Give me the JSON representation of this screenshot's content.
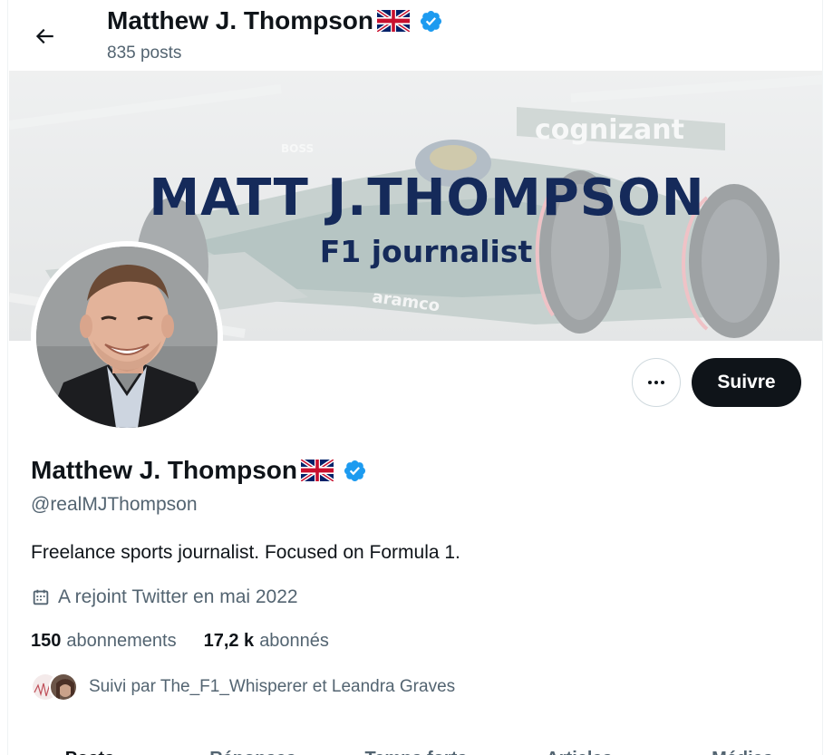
{
  "header": {
    "name": "Matthew J. Thompson",
    "posts": "835 posts"
  },
  "banner": {
    "title": "MATT J.THOMPSON",
    "subtitle": "F1 journalist",
    "car_sponsor": "cognizant",
    "car_sponsor_2": "aramco",
    "car_sponsor_3": "BOSS"
  },
  "actions": {
    "follow_label": "Suivre",
    "more_label": "•••"
  },
  "profile": {
    "name": "Matthew J. Thompson",
    "handle": "@realMJThompson",
    "bio": "Freelance sports journalist. Focused on Formula 1.",
    "joined": "A rejoint Twitter en mai 2022",
    "following_count": "150",
    "following_label": "abonnements",
    "followers_count": "17,2 k",
    "followers_label": "abonnés",
    "followed_by": "Suivi par The_F1_Whisperer et Leandra Graves"
  },
  "tabs": [
    "Posts",
    "Réponses",
    "Temps forts",
    "Articles",
    "Médias"
  ],
  "icons": {
    "back": "arrow-left-icon",
    "verified": "verified-badge-icon",
    "flag": "uk-flag-icon",
    "calendar": "calendar-icon",
    "more": "more-horizontal-icon"
  },
  "colors": {
    "verified": "#1d9bf0",
    "follow_button_bg": "#0f1419",
    "secondary_text": "#536471",
    "banner_text": "#152a5a"
  }
}
